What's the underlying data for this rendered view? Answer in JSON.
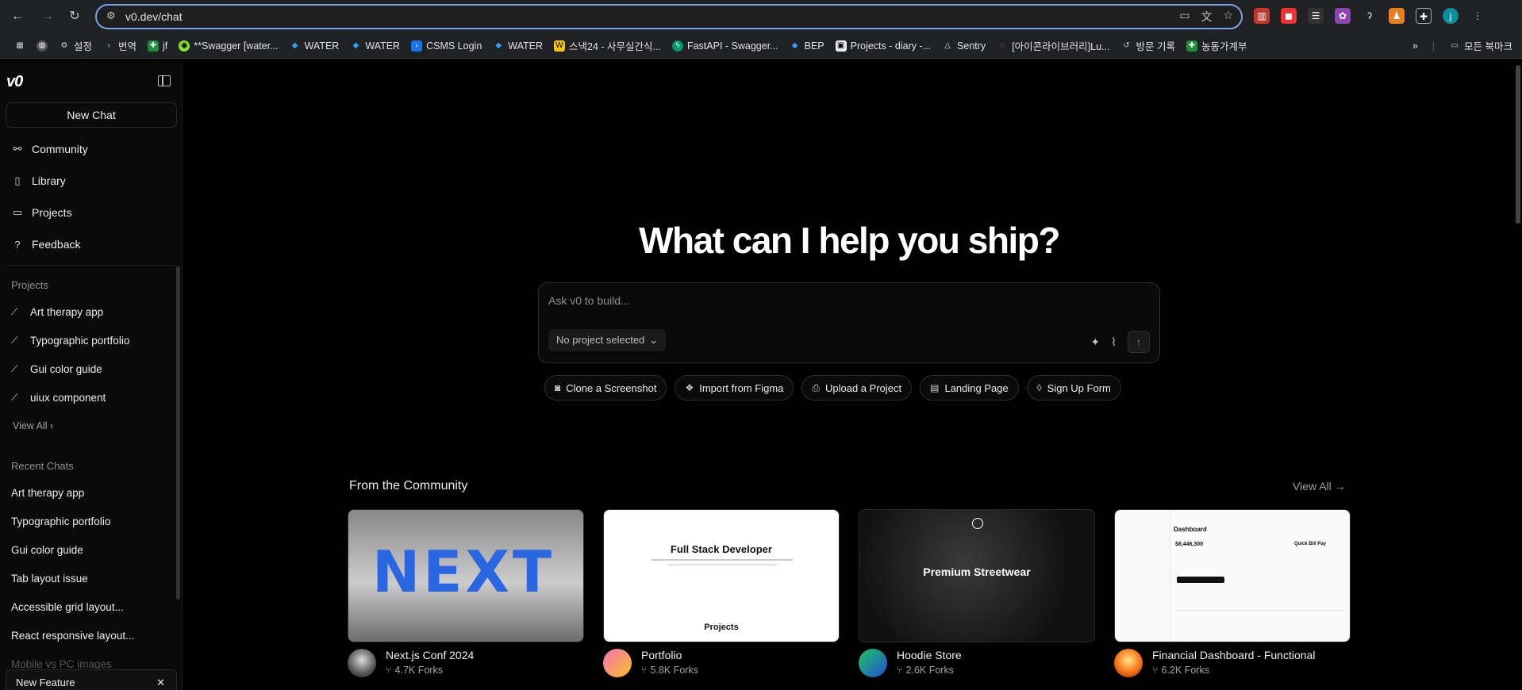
{
  "browser": {
    "url": "v0.dev/chat",
    "bookmarks": [
      {
        "label": "",
        "icon": "apps-icon"
      },
      {
        "label": "",
        "icon": "globe-icon"
      },
      {
        "label": "설정",
        "icon": "gear-icon"
      },
      {
        "label": "번역",
        "icon": "translate-icon"
      },
      {
        "label": "jf",
        "icon": "sheet-icon"
      },
      {
        "label": "**Swagger [water...",
        "icon": "swagger-icon"
      },
      {
        "label": "WATER",
        "icon": "water-icon"
      },
      {
        "label": "WATER",
        "icon": "water-icon"
      },
      {
        "label": "CSMS Login",
        "icon": "terminal-icon"
      },
      {
        "label": "WATER",
        "icon": "water-icon"
      },
      {
        "label": "스낵24 - 사무실간식...",
        "icon": "snack-icon"
      },
      {
        "label": "FastAPI - Swagger...",
        "icon": "fastapi-icon"
      },
      {
        "label": "BEP",
        "icon": "water-icon"
      },
      {
        "label": "Projects - diary -...",
        "icon": "github-icon"
      },
      {
        "label": "Sentry",
        "icon": "sentry-icon"
      },
      {
        "label": "[아이콘라이브러리]Lu...",
        "icon": "lucide-icon"
      },
      {
        "label": "방문 기록",
        "icon": "history-icon"
      },
      {
        "label": "농동가계부",
        "icon": "sheet-icon"
      }
    ],
    "bookmarks_more": "»",
    "bookmarks_all": "모든 북마크",
    "profile_initial": "j"
  },
  "sidebar": {
    "logo": "v0",
    "new_chat": "New Chat",
    "nav": [
      {
        "label": "Community",
        "icon": "community-icon"
      },
      {
        "label": "Library",
        "icon": "library-icon"
      },
      {
        "label": "Projects",
        "icon": "folder-icon"
      },
      {
        "label": "Feedback",
        "icon": "help-icon"
      }
    ],
    "projects_label": "Projects",
    "projects": [
      "Art therapy app",
      "Typographic portfolio",
      "Gui color guide",
      "uiux component"
    ],
    "view_all": "View All",
    "recent_label": "Recent Chats",
    "recent": [
      "Art therapy app",
      "Typographic portfolio",
      "Gui color guide",
      "Tab layout issue",
      "Accessible grid layout...",
      "React responsive layout...",
      "Mobile vs PC images"
    ],
    "feature_card": "New Feature"
  },
  "main": {
    "hero": "What can I help you ship?",
    "prompt_placeholder": "Ask v0 to build...",
    "project_select": "No project selected",
    "chips": [
      {
        "label": "Clone a Screenshot",
        "icon": "camera-icon"
      },
      {
        "label": "Import from Figma",
        "icon": "figma-icon"
      },
      {
        "label": "Upload a Project",
        "icon": "file-upload-icon"
      },
      {
        "label": "Landing Page",
        "icon": "layout-icon"
      },
      {
        "label": "Sign Up Form",
        "icon": "droplet-icon"
      }
    ],
    "community_title": "From the Community",
    "community_view_all": "View All",
    "cards": [
      {
        "title": "Next.js Conf 2024",
        "forks": "4.7K Forks",
        "thumb_text": "NEXT"
      },
      {
        "title": "Portfolio",
        "forks": "5.8K Forks",
        "thumb_text": "Full Stack Developer",
        "thumb_sub": "Projects"
      },
      {
        "title": "Hoodie Store",
        "forks": "2.6K Forks",
        "thumb_text": "Premium Streetwear"
      },
      {
        "title": "Financial Dashboard - Functional",
        "forks": "6.2K Forks",
        "thumb_text": "Dashboard",
        "thumb_sub": "Quick Bill Pay",
        "thumb_amount": "$8,446,300"
      }
    ]
  }
}
